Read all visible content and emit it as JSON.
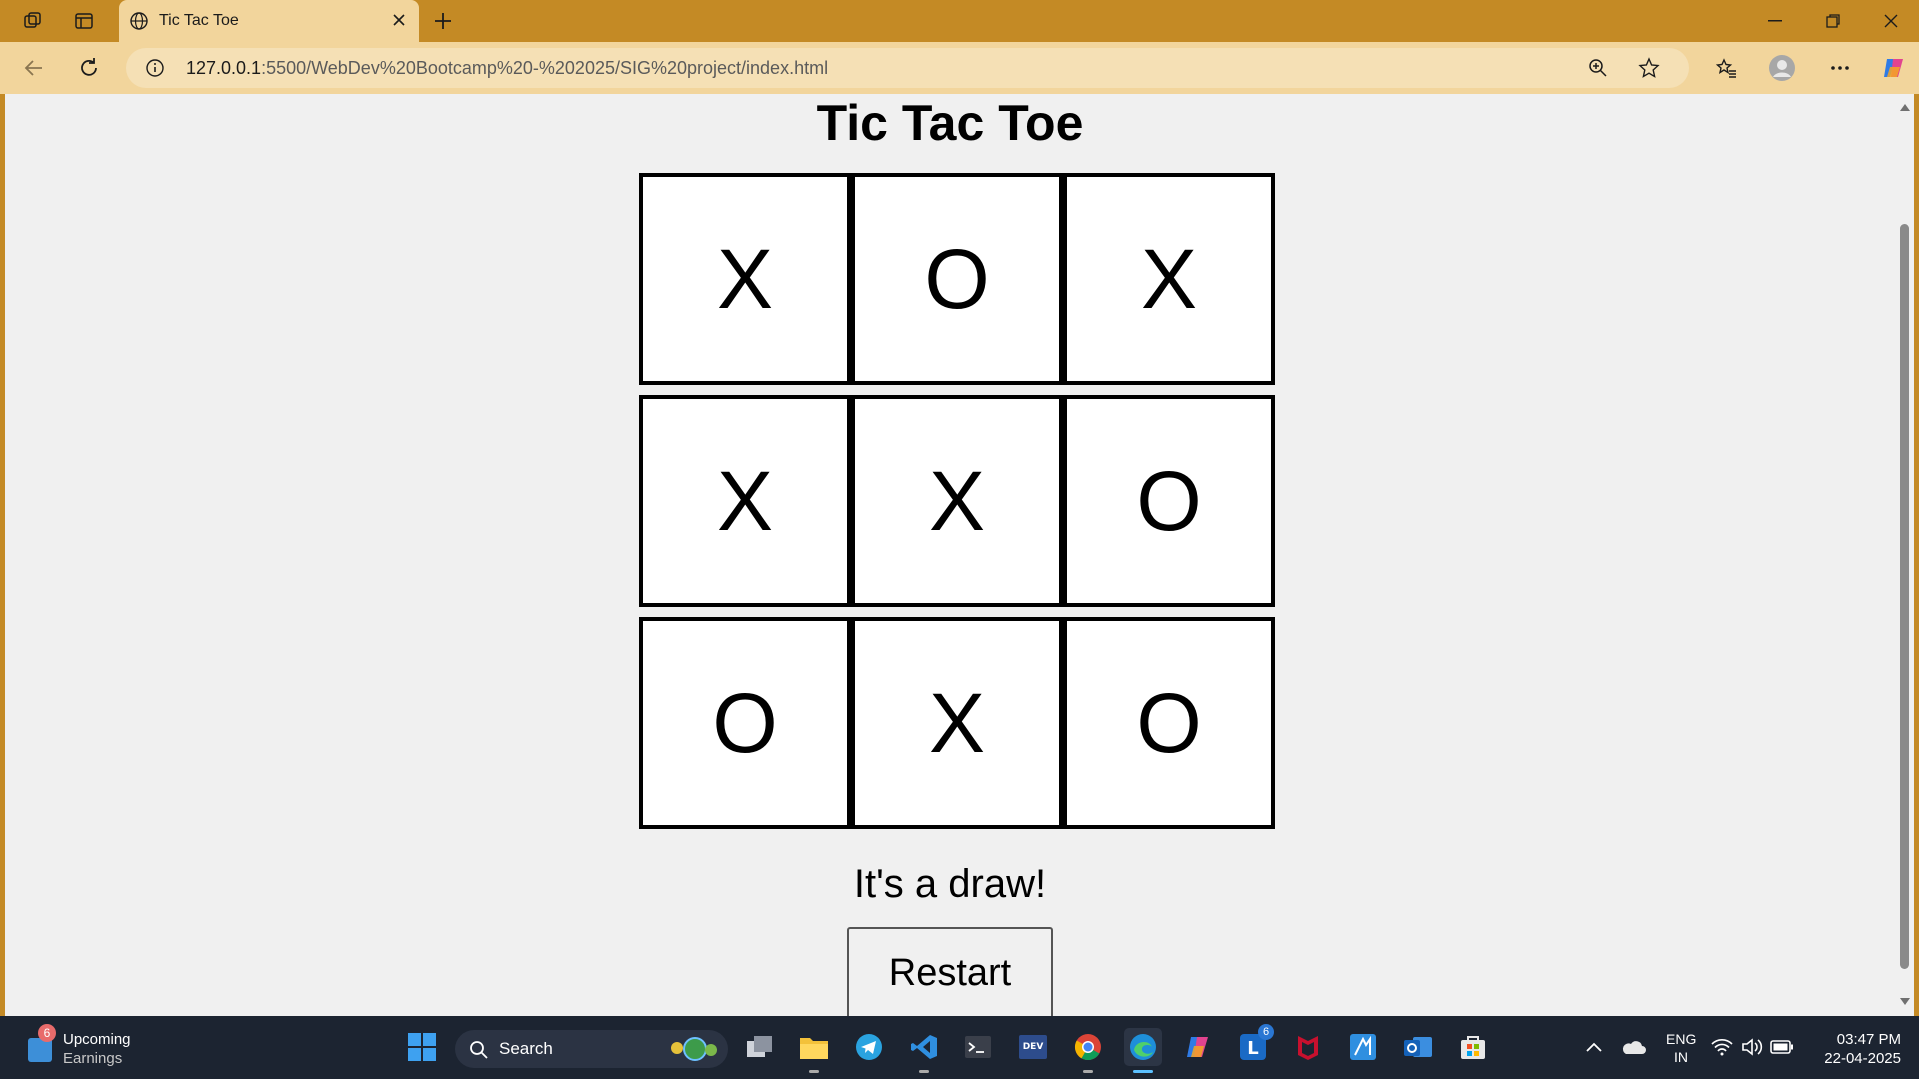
{
  "browser": {
    "tab_title": "Tic Tac Toe",
    "url_host": "127.0.0.1",
    "url_rest": ":5500/WebDev%20Bootcamp%20-%202025/SIG%20project/index.html"
  },
  "page": {
    "title": "Tic Tac Toe",
    "board": [
      "X",
      "O",
      "X",
      "X",
      "X",
      "O",
      "O",
      "X",
      "O"
    ],
    "status": "It's a draw!",
    "restart_label": "Restart"
  },
  "taskbar": {
    "weather_badge": "6",
    "weather_title": "Upcoming",
    "weather_sub": "Earnings",
    "search_label": "Search",
    "lang_top": "ENG",
    "lang_bottom": "IN",
    "time": "03:47 PM",
    "date": "22-04-2025",
    "l_badge": "6"
  }
}
